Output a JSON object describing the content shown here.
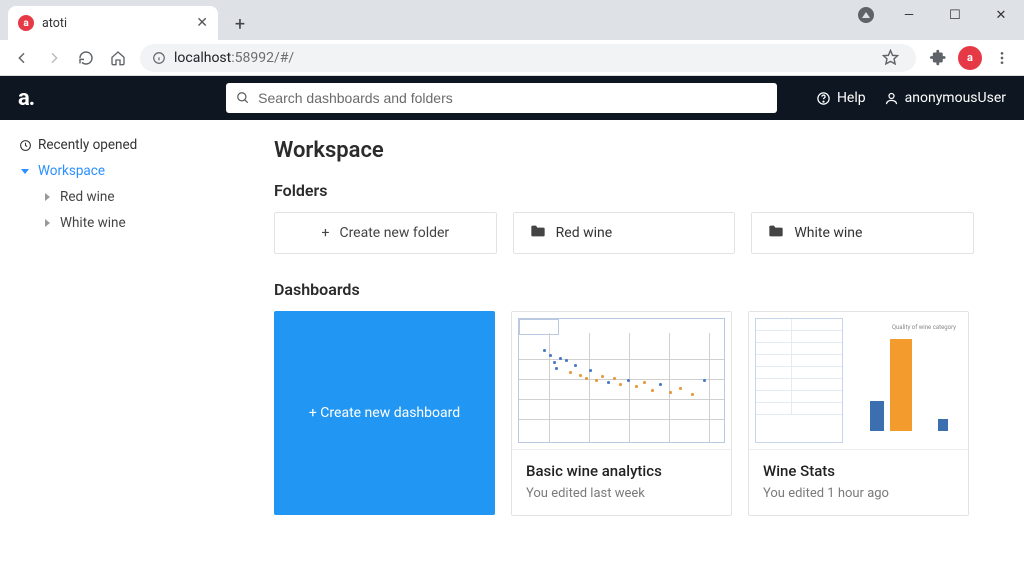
{
  "browser": {
    "tab_title": "atoti",
    "url_host": "localhost",
    "url_rest": ":58992/#/"
  },
  "app": {
    "logo": "a.",
    "search_placeholder": "Search dashboards and folders",
    "help": "Help",
    "user": "anonymousUser"
  },
  "sidebar": {
    "recently_opened": "Recently opened",
    "workspace": "Workspace",
    "items": [
      "Red wine",
      "White wine"
    ]
  },
  "content": {
    "title": "Workspace",
    "folders_heading": "Folders",
    "create_folder": "Create new folder",
    "folders": [
      "Red wine",
      "White wine"
    ],
    "dashboards_heading": "Dashboards",
    "create_dashboard": "Create new dashboard",
    "dashboards": [
      {
        "title": "Basic wine analytics",
        "sub": "You edited last week"
      },
      {
        "title": "Wine Stats",
        "sub": "You edited 1 hour ago"
      }
    ]
  }
}
